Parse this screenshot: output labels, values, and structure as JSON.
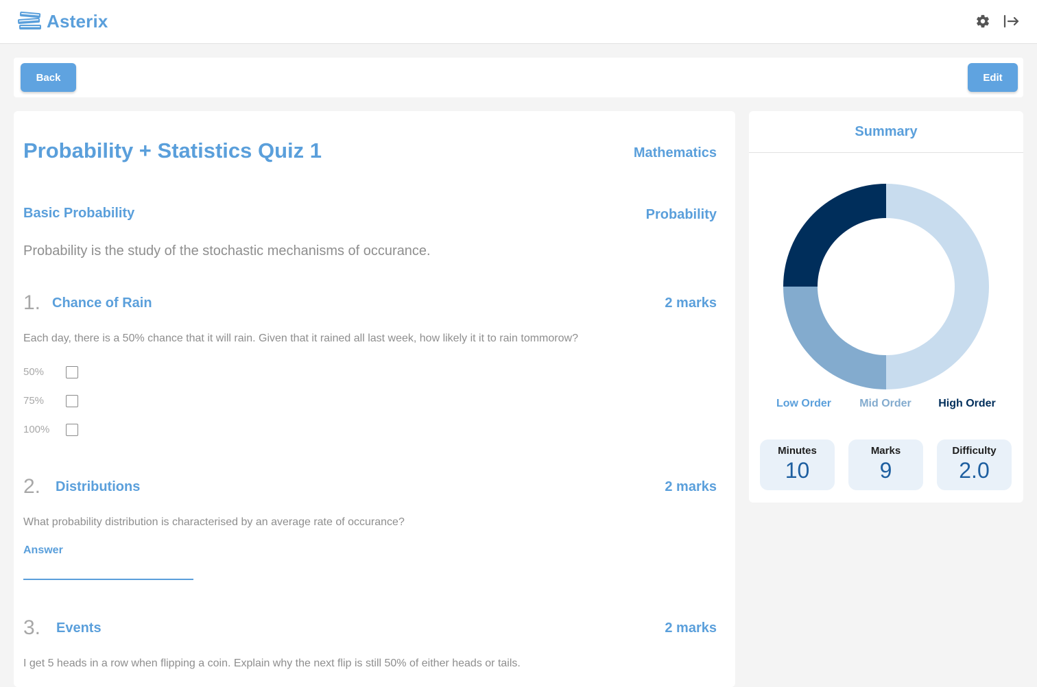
{
  "app": {
    "name": "Asterix"
  },
  "header": {
    "settings_icon": "gear-icon",
    "logout_icon": "logout-arrow-icon"
  },
  "toolbar": {
    "back_label": "Back",
    "edit_label": "Edit"
  },
  "quiz": {
    "title": "Probability + Statistics Quiz 1",
    "subject": "Mathematics",
    "section": {
      "title": "Basic Probability",
      "topic": "Probability",
      "description": "Probability is the study of the stochastic mechanisms of occurance."
    },
    "questions": [
      {
        "number": "1.",
        "title": "Chance of Rain",
        "marks": "2 marks",
        "text": "Each day, there is a 50% chance that it will rain. Given that it rained all last week, how likely it it to rain tommorow?",
        "options": [
          {
            "label": "50%",
            "checked": false
          },
          {
            "label": "75%",
            "checked": false
          },
          {
            "label": "100%",
            "checked": false
          }
        ]
      },
      {
        "number": "2.",
        "title": "Distributions",
        "marks": "2 marks",
        "text": "What probability distribution is characterised by an average rate of occurance?",
        "answer_label": "Answer",
        "answer_value": ""
      },
      {
        "number": "3.",
        "title": "Events",
        "marks": "2 marks",
        "text": "I get 5 heads in a row when flipping a coin. Explain why the next flip is still 50% of either heads or tails."
      }
    ]
  },
  "summary": {
    "title": "Summary",
    "legend": [
      {
        "label": "Low Order",
        "color": "#5a9fdb"
      },
      {
        "label": "Mid Order",
        "color": "#83abce"
      },
      {
        "label": "High Order",
        "color": "#002e5b"
      }
    ],
    "stats": [
      {
        "label": "Minutes",
        "value": "10"
      },
      {
        "label": "Marks",
        "value": "9"
      },
      {
        "label": "Difficulty",
        "value": "2.0"
      }
    ]
  },
  "chart_data": {
    "type": "pie",
    "series": [
      {
        "name": "Low Order",
        "values": [
          50
        ],
        "color": "#c8dcee"
      },
      {
        "name": "Mid Order",
        "values": [
          25
        ],
        "color": "#83abce"
      },
      {
        "name": "High Order",
        "values": [
          25
        ],
        "color": "#002e5b"
      }
    ],
    "donut": true
  }
}
